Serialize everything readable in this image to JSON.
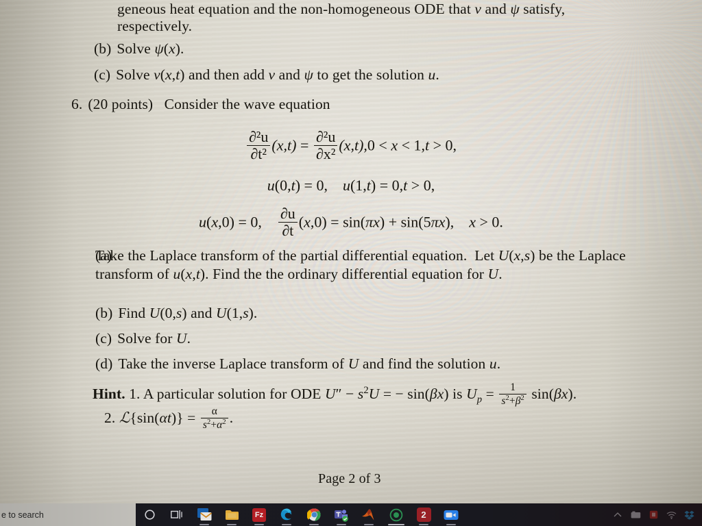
{
  "document": {
    "top_paragraph": {
      "line1": "geneous heat equation and the non-homogeneous ODE that v and ψ satisfy,",
      "line2": "respectively."
    },
    "prev_items": [
      {
        "label": "(b)",
        "text": "Solve ψ(x)."
      },
      {
        "label": "(c)",
        "text": "Solve v(x, t) and then add v and ψ to get the solution u."
      }
    ],
    "problem": {
      "number": "6.",
      "points": "(20 points)",
      "prompt": "Consider the wave equation",
      "equations": {
        "pde": {
          "lhs_num": "∂²u",
          "lhs_den": "∂t²",
          "lhs_args": "(x, t)",
          "relation": "=",
          "rhs_num": "∂²u",
          "rhs_den": "∂x²",
          "rhs_args": "(x, t),",
          "domain": "0 < x < 1, t > 0,"
        },
        "boundary": {
          "left": "u(0, t) = 0,",
          "right": "u(1, t) = 0, t > 0,"
        },
        "initial": {
          "first": "u(x, 0) = 0,",
          "deriv_num": "∂u",
          "deriv_den": "∂t",
          "deriv_args": "(x, 0)",
          "equals": "=",
          "rhs": "sin(πx) + sin(5πx),",
          "domain": "x > 0."
        }
      },
      "items": [
        {
          "label": "(a)",
          "text": "Take the Laplace transform of the partial differential equation.  Let U(x,s) be the Laplace transform of u(x, t). Find the the ordinary differential equation for U."
        },
        {
          "label": "(b)",
          "text": "Find U(0, s) and U(1, s)."
        },
        {
          "label": "(c)",
          "text": "Solve for U."
        },
        {
          "label": "(d)",
          "text": "Take the inverse Laplace transform of U and find the solution u."
        }
      ]
    },
    "hint": {
      "heading": "Hint.",
      "item1": {
        "number": "1.",
        "text_before": "A particular solution for ODE",
        "ode": "U'' − s²U = − sin(βx)",
        "is_word": "is",
        "solution_name": "U",
        "solution_sub": "p",
        "equals": "=",
        "frac_num": "1",
        "frac_den": "s²+β²",
        "frac_tail": "sin(βx)."
      },
      "item2": {
        "number": "2.",
        "text": "L{sin(αt)}",
        "equals": "=",
        "frac_num": "α",
        "frac_den": "s²+α²",
        "tail": "."
      }
    },
    "footer": "Page 2 of 3"
  },
  "taskbar": {
    "search_placeholder": "e to search",
    "items": [
      {
        "name": "cortana",
        "glyph": "◯",
        "label": "Cortana"
      },
      {
        "name": "task-view",
        "glyph": "▤",
        "label": "Task View"
      },
      {
        "name": "mail",
        "glyph": "✉",
        "label": "Mail",
        "color": "#1a6fc4"
      },
      {
        "name": "file-explorer",
        "glyph": "🗀",
        "label": "File Explorer",
        "color": "#e8ab3a"
      },
      {
        "name": "filezilla",
        "glyph": "Fz",
        "label": "FileZilla",
        "color": "#bf2026"
      },
      {
        "name": "edge",
        "glyph": "",
        "label": "Microsoft Edge",
        "color": "#1a9ad7"
      },
      {
        "name": "chrome",
        "glyph": "",
        "label": "Google Chrome",
        "color": "#34a853"
      },
      {
        "name": "teams",
        "glyph": "T",
        "label": "Microsoft Teams",
        "color": "#5558af"
      },
      {
        "name": "matlab",
        "glyph": "",
        "label": "MATLAB",
        "color": "#e2621b"
      },
      {
        "name": "app-green-circle",
        "glyph": "◉",
        "label": "Running app",
        "color": "#2f7d46"
      },
      {
        "name": "app-red-two",
        "glyph": "2",
        "label": "Running app",
        "color": "#a7232a"
      },
      {
        "name": "zoom",
        "glyph": "🎥",
        "label": "Zoom",
        "color": "#2d8cff"
      }
    ],
    "tray": [
      {
        "name": "show-hidden-icons",
        "glyph": "⌃"
      },
      {
        "name": "tray-app",
        "glyph": "▭"
      },
      {
        "name": "tray-red-app",
        "glyph": "▢"
      },
      {
        "name": "network",
        "glyph": "◿"
      },
      {
        "name": "dropbox",
        "glyph": "✥"
      }
    ]
  },
  "colors": {
    "paper": "#dedbd1",
    "ink": "#17150f",
    "taskbar": "#1b1b22",
    "search_field": "#d5d3cd"
  }
}
